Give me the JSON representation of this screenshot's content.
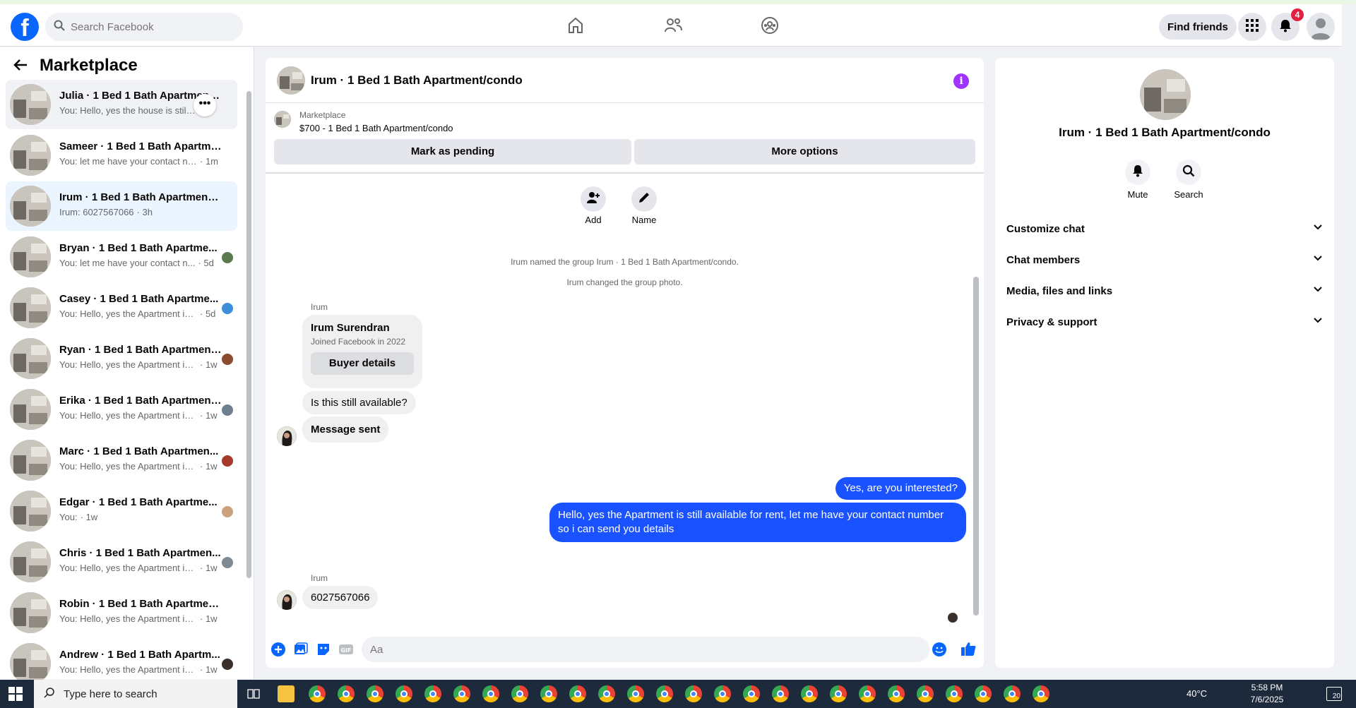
{
  "topbar": {
    "search_placeholder": "Search Facebook",
    "find_friends": "Find friends",
    "notifications_count": "4"
  },
  "left": {
    "title": "Marketplace",
    "conversations": [
      {
        "title": "Julia · 1 Bed 1 Bath Apartment/condo",
        "msg": "You: Hello, yes the house is still available",
        "time": ""
      },
      {
        "title": "Sameer · 1 Bed 1 Bath Apartmen...",
        "msg": "You: let me have your contact num...",
        "time": "· 1m"
      },
      {
        "title": "Irum · 1 Bed 1 Bath Apartment/c...",
        "msg": "Irum: 6027567066",
        "time": "· 3h"
      },
      {
        "title": "Bryan · 1 Bed 1 Bath Apartme...",
        "msg": "You: let me have your contact n...",
        "time": "· 5d"
      },
      {
        "title": "Casey · 1 Bed 1 Bath Apartme...",
        "msg": "You: Hello, yes the Apartment is ...",
        "time": "· 5d"
      },
      {
        "title": "Ryan · 1 Bed 1 Bath Apartment...",
        "msg": "You: Hello, yes the Apartment is ...",
        "time": "· 1w"
      },
      {
        "title": "Erika · 1 Bed 1 Bath Apartment...",
        "msg": "You: Hello, yes the Apartment is ...",
        "time": "· 1w"
      },
      {
        "title": "Marc · 1 Bed 1 Bath Apartmen...",
        "msg": "You: Hello, yes the Apartment is ...",
        "time": "· 1w"
      },
      {
        "title": "Edgar · 1 Bed 1 Bath Apartme...",
        "msg": "You:",
        "time": "· 1w"
      },
      {
        "title": "Chris · 1 Bed 1 Bath Apartmen...",
        "msg": "You: Hello, yes the Apartment is ...",
        "time": "· 1w"
      },
      {
        "title": "Robin · 1 Bed 1 Bath Apartment/...",
        "msg": "You: Hello, yes the Apartment is stil...",
        "time": "· 1w"
      },
      {
        "title": "Andrew · 1 Bed 1 Bath Apartm...",
        "msg": "You: Hello, yes the Apartment is ...",
        "time": "· 1w"
      }
    ]
  },
  "chat": {
    "title": "Irum · 1 Bed 1 Bath Apartment/condo",
    "marketplace_label": "Marketplace",
    "listing": "$700 - 1 Bed 1 Bath Apartment/condo",
    "mark_pending": "Mark as pending",
    "more_options": "More options",
    "add_label": "Add",
    "name_label": "Name",
    "sys1": "Irum named the group Irum · 1 Bed 1 Bath Apartment/condo.",
    "sys2": "Irum changed the group photo.",
    "sender1": "Irum",
    "card_name": "Irum Surendran",
    "card_joined": "Joined Facebook in 2022",
    "buyer_details": "Buyer details",
    "msg_available": "Is this still available?",
    "msg_sent": "Message sent",
    "out1": "Yes, are you interested?",
    "out2": "Hello, yes the Apartment is still available for rent, let me have your contact number so i can send you details",
    "sender2": "Irum",
    "msg_phone": "6027567066",
    "composer_placeholder": "Aa"
  },
  "right": {
    "title": "Irum · 1 Bed 1 Bath Apartment/condo",
    "mute": "Mute",
    "search": "Search",
    "rows": [
      "Customize chat",
      "Chat members",
      "Media, files and links",
      "Privacy & support"
    ]
  },
  "taskbar": {
    "search_placeholder": "Type here to search",
    "temp": "40°C",
    "time": "5:58 PM",
    "date": "7/6/2025",
    "notif": "20"
  }
}
